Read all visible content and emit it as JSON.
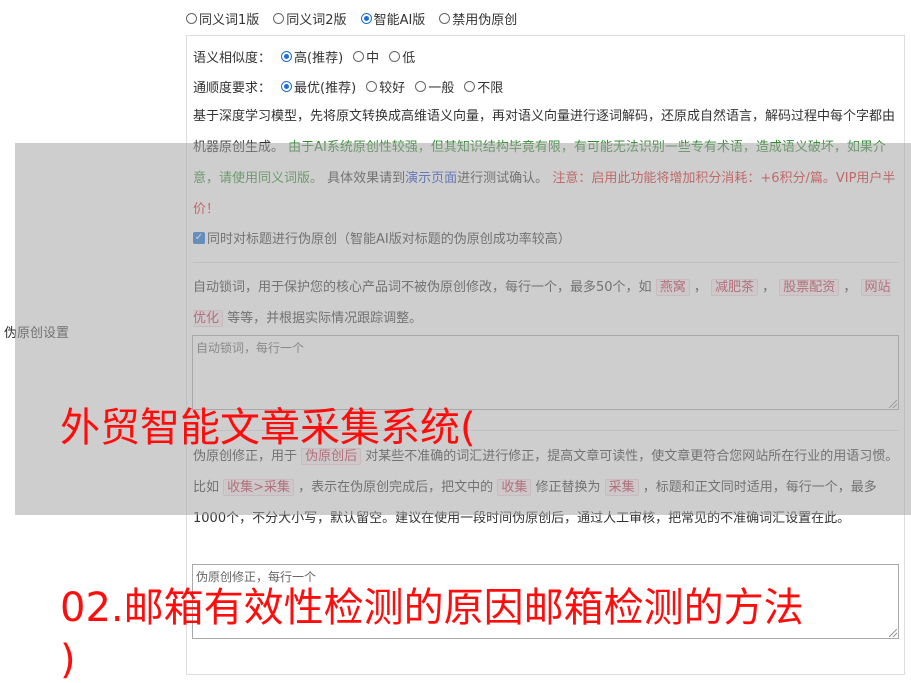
{
  "modes": [
    {
      "label": "同义词1版",
      "selected": false
    },
    {
      "label": "同义词2版",
      "selected": false
    },
    {
      "label": "智能AI版",
      "selected": true
    },
    {
      "label": "禁用伪原创",
      "selected": false
    }
  ],
  "similarity": {
    "label": "语义相似度：",
    "options": [
      {
        "label": "高(推荐)",
        "selected": true
      },
      {
        "label": "中",
        "selected": false
      },
      {
        "label": "低",
        "selected": false
      }
    ]
  },
  "fluency": {
    "label": "通顺度要求：",
    "options": [
      {
        "label": "最优(推荐)",
        "selected": true
      },
      {
        "label": "较好",
        "selected": false
      },
      {
        "label": "一般",
        "selected": false
      },
      {
        "label": "不限",
        "selected": false
      }
    ]
  },
  "ai_desc": {
    "p1": "基于深度学习模型，先将原文转换成高维语义向量，再对语义向量进行逐词解码，还原成自然语言，解码过程中每个字都由机器原创生成。 ",
    "p2": "由于AI系统原创性较强，但其知识结构毕竟有限，有可能无法识别一些专有术语，造成语义破坏，如果介意，请使用同义词版。",
    "p3": " 具体效果请到",
    "link": "演示页面",
    "p4": "进行测试确认。 ",
    "p5": "注意：启用此功能将增加积分消耗：+6积分/篇。VIP用户半价！"
  },
  "title_checkbox": {
    "label": "同时对标题进行伪原创（智能AI版对标题的伪原创成功率较高）",
    "checked": true
  },
  "lock": {
    "t1": "自动锁词，用于保护您的核心产品词不被伪原创修改，每行一个，最多50个，如 ",
    "tags": [
      "燕窝",
      "减肥茶",
      "股票配资",
      "网站优化"
    ],
    "t2": " 等等，并根据实际情况跟踪调整。",
    "placeholder": "自动锁词，每行一个"
  },
  "correct": {
    "t1": "伪原创修正，用于 ",
    "tag1": "伪原创后",
    "t2": " 对某些不准确的词汇进行修正，提高文章可读性，使文章更符合您网站所在行业的用语习惯。比如 ",
    "tag2": "收集>采集",
    "t3": " ，表示在伪原创完成后，把文中的 ",
    "tag3": "收集",
    "t4": " 修正替换为 ",
    "tag4": "采集",
    "t5": " ，标题和正文同时适用，每行一个，最多1000个，不分大小写，默认留空。建议在使用一段时间伪原创后，通过人工审核，把常见的不准确词汇设置在此。",
    "placeholder": "伪原创修正，每行一个"
  },
  "side_label": "伪原创设置",
  "headline": {
    "line1": "外贸智能文章采集系统(",
    "line2": "02.邮箱有效性检测的原因邮箱检测的方法",
    "line3": ")"
  },
  "colors": {
    "accent": "#1a6fd8",
    "green": "#2e8b2e",
    "red": "#e02020",
    "overlay_text": "#ff0d0d"
  }
}
